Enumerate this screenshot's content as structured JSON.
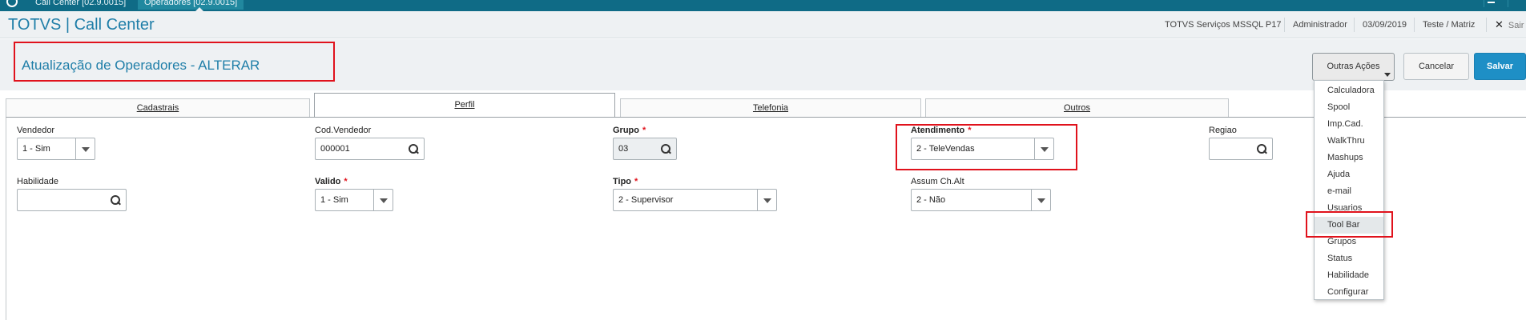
{
  "topbar": {
    "tabs": [
      "Call Center [02.9.0015]",
      "Operadores [02.9.0015]"
    ]
  },
  "header": {
    "brand": "TOTVS | Call Center",
    "server": "TOTVS Serviços MSSQL P17",
    "user": "Administrador",
    "date": "03/09/2019",
    "company": "Teste / Matriz",
    "exit_label": "Sair"
  },
  "page": {
    "title": "Atualização de Operadores - ALTERAR"
  },
  "actions": {
    "more_label": "Outras Ações",
    "cancel_label": "Cancelar",
    "save_label": "Salvar"
  },
  "tabs": [
    "Cadastrais",
    "Perfil",
    "Telefonia",
    "Outros"
  ],
  "active_tab": "Perfil",
  "fields": {
    "vendedor": {
      "label": "Vendedor",
      "value": "1 - Sim"
    },
    "cod_vendedor": {
      "label": "Cod.Vendedor",
      "value": "000001"
    },
    "grupo": {
      "label": "Grupo",
      "value": "03",
      "required": "*"
    },
    "atendimento": {
      "label": "Atendimento",
      "value": "2 - TeleVendas",
      "required": "*"
    },
    "regiao": {
      "label": "Regiao",
      "value": ""
    },
    "habilidade": {
      "label": "Habilidade",
      "value": ""
    },
    "valido": {
      "label": "Valido",
      "value": "1 - Sim",
      "required": "*"
    },
    "tipo": {
      "label": "Tipo",
      "value": "2 - Supervisor",
      "required": "*"
    },
    "assum_ch_alt": {
      "label": "Assum Ch.Alt",
      "value": "2 - Não"
    }
  },
  "menu": {
    "items": [
      "Calculadora",
      "Spool",
      "Imp.Cad.",
      "WalkThru",
      "Mashups",
      "Ajuda",
      "e-mail",
      "Usuarios",
      "Tool Bar",
      "Grupos",
      "Status",
      "Habilidade",
      "Configurar"
    ],
    "highlighted": "Tool Bar"
  },
  "colors": {
    "topbar": "#0f6b86",
    "brand": "#1f7ea8",
    "save": "#1e8fc6",
    "highlight_box": "#e0121c"
  }
}
